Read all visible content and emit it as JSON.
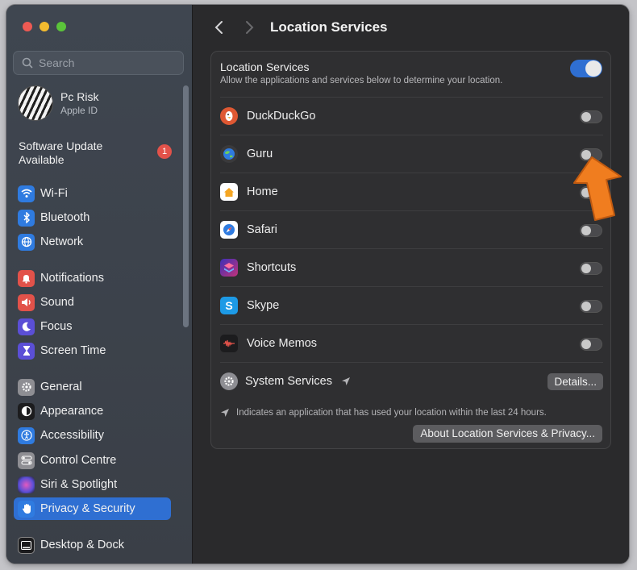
{
  "window": {
    "traffic_lights": [
      "close",
      "minimize",
      "zoom"
    ]
  },
  "search": {
    "placeholder": "Search"
  },
  "profile": {
    "name": "Pc Risk",
    "subtitle": "Apple ID"
  },
  "update": {
    "label": "Software Update Available",
    "badge": "1"
  },
  "sidebar": {
    "items": [
      {
        "label": "Wi-Fi",
        "icon": "wifi-icon",
        "color": "#2f7be0"
      },
      {
        "label": "Bluetooth",
        "icon": "bluetooth-icon",
        "color": "#2f7be0"
      },
      {
        "label": "Network",
        "icon": "globe-icon",
        "color": "#2f7be0"
      },
      {
        "label": "Notifications",
        "icon": "bell-icon",
        "color": "#e2524a"
      },
      {
        "label": "Sound",
        "icon": "speaker-icon",
        "color": "#e2524a"
      },
      {
        "label": "Focus",
        "icon": "moon-icon",
        "color": "#5b4fd6"
      },
      {
        "label": "Screen Time",
        "icon": "hourglass-icon",
        "color": "#5b4fd6"
      },
      {
        "label": "General",
        "icon": "gear-icon",
        "color": "#8e8e93"
      },
      {
        "label": "Appearance",
        "icon": "appearance-icon",
        "color": "#1c1c1e"
      },
      {
        "label": "Accessibility",
        "icon": "accessibility-icon",
        "color": "#2f7be0"
      },
      {
        "label": "Control Centre",
        "icon": "control-centre-icon",
        "color": "#8e8e93"
      },
      {
        "label": "Siri & Spotlight",
        "icon": "siri-icon",
        "color": "#7b4fd6"
      },
      {
        "label": "Privacy & Security",
        "icon": "hand-icon",
        "color": "#2f7be0",
        "selected": true
      },
      {
        "label": "Desktop & Dock",
        "icon": "dock-icon",
        "color": "#1c1c1e"
      }
    ]
  },
  "toolbar": {
    "title": "Location Services"
  },
  "card": {
    "title": "Location Services",
    "subtitle": "Allow the applications and services below to determine your location.",
    "master_toggle_on": true,
    "apps": [
      {
        "name": "DuckDuckGo",
        "icon": "duckduckgo-icon",
        "color": "#de5833",
        "enabled": false
      },
      {
        "name": "Guru",
        "icon": "guru-icon",
        "color": "#3a3a3c",
        "enabled": false
      },
      {
        "name": "Home",
        "icon": "home-icon",
        "color": "#f5a623",
        "enabled": false
      },
      {
        "name": "Safari",
        "icon": "safari-icon",
        "color": "#2f7be0",
        "enabled": false
      },
      {
        "name": "Shortcuts",
        "icon": "shortcuts-icon",
        "color": "#3b2fb8",
        "enabled": false
      },
      {
        "name": "Skype",
        "icon": "skype-icon",
        "color": "#1d9ae6",
        "enabled": false
      },
      {
        "name": "Voice Memos",
        "icon": "voice-memos-icon",
        "color": "#1c1c1e",
        "enabled": false
      }
    ],
    "system_services": {
      "name": "System Services",
      "button": "Details..."
    },
    "footnote": "Indicates an application that has used your location within the last 24 hours.",
    "about_button": "About Location Services & Privacy..."
  },
  "accent": "#2f6fd2",
  "annotation": {
    "arrow_color": "#f07d1f"
  }
}
